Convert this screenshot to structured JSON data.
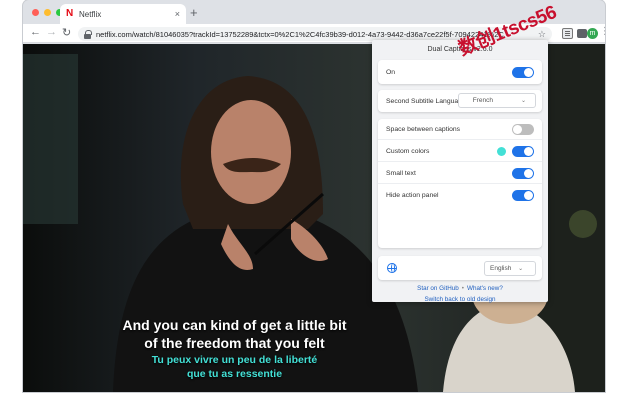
{
  "colors": {
    "accent": "#1f73e8",
    "subtitle_secondary": "#43e0d6",
    "brand": "#e50914",
    "watermark": "#c8102e"
  },
  "browser": {
    "tab": {
      "title": "Netflix",
      "favicon_letter": "N",
      "close_glyph": "×"
    },
    "newtab_glyph": "+",
    "nav": {
      "back": "←",
      "forward": "→",
      "reload": "↻"
    },
    "url": "netflix.com/watch/81046035?trackId=13752289&tctx=0%2C1%2C4fc39b39-d012-4a73-9442-d36a7ce22f5f-70942241%2C",
    "star": "☆",
    "avatar_letter": "m",
    "menu": "⋮"
  },
  "video": {
    "subtitles_primary": [
      "And you can kind of get a little bit",
      "of the freedom that you felt"
    ],
    "subtitles_secondary": [
      "Tu peux vivre un peu de la liberté",
      "que tu as ressentie"
    ]
  },
  "popup": {
    "title": "Dual Captions v2.6.0",
    "main_toggle": {
      "label": "On",
      "enabled": true
    },
    "second_language": {
      "label": "Second Subtitle Language",
      "value": "French",
      "chevron": "⌄"
    },
    "options": [
      {
        "label": "Space between captions",
        "enabled": false
      },
      {
        "label": "Custom colors",
        "enabled": true,
        "swatch": "#43e0d6"
      },
      {
        "label": "Small text",
        "enabled": true
      },
      {
        "label": "Hide action panel",
        "enabled": true
      }
    ],
    "ui_language": {
      "icon": "globe-icon",
      "value": "English",
      "chevron": "⌄"
    },
    "links": {
      "github": "Star on GitHub",
      "separator": "•",
      "whats_new": "What's new?",
      "old_design": "Switch back to old design"
    }
  },
  "watermark": "数创1tscs56"
}
